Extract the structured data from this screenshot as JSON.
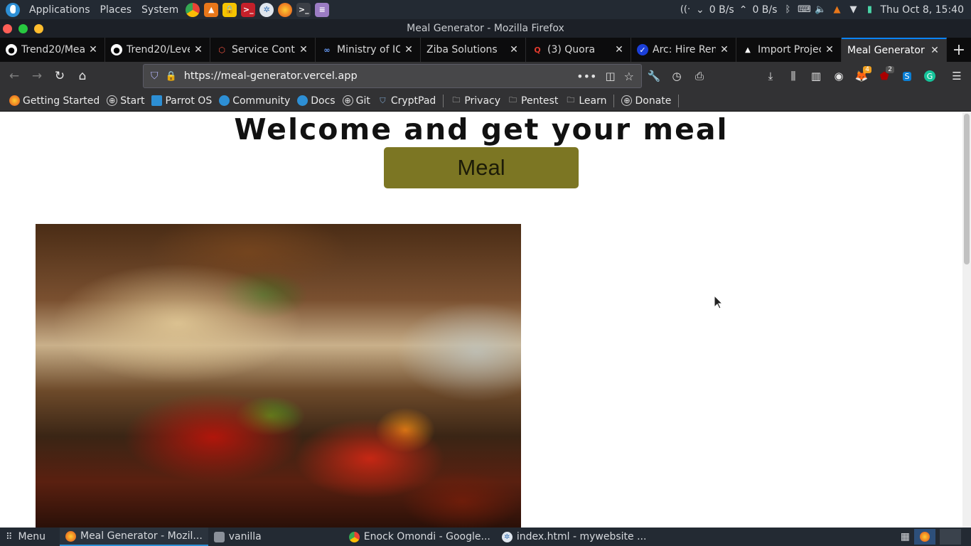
{
  "system_panel": {
    "menus": [
      "Applications",
      "Places",
      "System"
    ],
    "network_speed": "0 B/s",
    "network_speed_up": "0 B/s",
    "datetime": "Thu Oct  8, 15:40"
  },
  "window": {
    "title": "Meal Generator - Mozilla Firefox"
  },
  "tabs": [
    {
      "label": "Trend20/Mea",
      "icon": "github-icon"
    },
    {
      "label": "Trend20/Leve",
      "icon": "github-icon"
    },
    {
      "label": "Service Conta",
      "icon": "laravel-icon"
    },
    {
      "label": "Ministry of IC",
      "icon": "infinity-icon"
    },
    {
      "label": "Ziba Solutions",
      "icon": "blank-icon"
    },
    {
      "label": "(3) Quora",
      "icon": "quora-icon"
    },
    {
      "label": "Arc: Hire Ren",
      "icon": "arc-icon"
    },
    {
      "label": "Import Projec",
      "icon": "vercel-icon"
    },
    {
      "label": "Meal Generator",
      "icon": "blank-icon",
      "active": true
    }
  ],
  "navbar": {
    "url": "https://meal-generator.vercel.app",
    "badges": {
      "foxyproxy": "4",
      "ublock": "2"
    }
  },
  "bookmarks": [
    {
      "label": "Getting Started",
      "icon": "firefox-icon"
    },
    {
      "label": "Start",
      "icon": "globe-icon"
    },
    {
      "label": "Parrot OS",
      "icon": "parrot-icon"
    },
    {
      "label": "Community",
      "icon": "parrot-icon"
    },
    {
      "label": "Docs",
      "icon": "parrot-icon"
    },
    {
      "label": "Git",
      "icon": "globe-icon"
    },
    {
      "label": "CryptPad",
      "icon": "cryptpad-icon"
    },
    {
      "label": "Privacy",
      "icon": "folder-icon"
    },
    {
      "label": "Pentest",
      "icon": "folder-icon"
    },
    {
      "label": "Learn",
      "icon": "folder-icon"
    },
    {
      "label": "Donate",
      "icon": "globe-icon"
    }
  ],
  "page": {
    "heading": "Welcome and get your meal",
    "button_label": "Meal"
  },
  "taskbar": {
    "menu_label": "Menu",
    "tasks": [
      {
        "label": "Meal Generator - Mozil...",
        "icon": "firefox-icon",
        "active": true
      },
      {
        "label": "vanilla",
        "icon": "folder-icon"
      },
      {
        "label": "Enock Omondi - Google...",
        "icon": "chrome-icon"
      },
      {
        "label": "index.html - mywebsite ...",
        "icon": "vscode-icon"
      }
    ]
  },
  "colors": {
    "meal_button": "#7c7623",
    "active_tab_accent": "#0a84ff",
    "panel_bg": "#232a33"
  }
}
